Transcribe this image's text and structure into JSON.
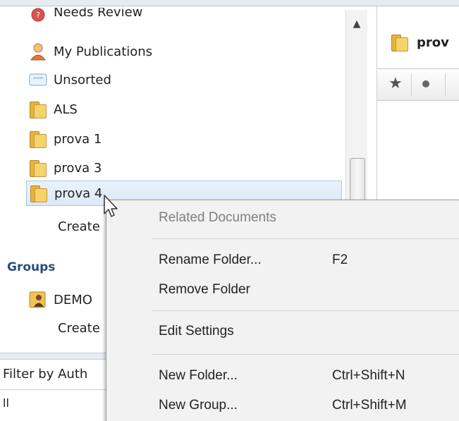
{
  "sidebar": {
    "items": [
      {
        "label": "Needs Review",
        "icon": "needs-review-icon"
      },
      {
        "label": "My Publications",
        "icon": "user-icon"
      },
      {
        "label": "Unsorted",
        "icon": "unsorted-icon"
      },
      {
        "label": "ALS",
        "icon": "folder-icon"
      },
      {
        "label": "prova 1",
        "icon": "folder-icon"
      },
      {
        "label": "prova 3",
        "icon": "folder-icon"
      },
      {
        "label": "prova 4",
        "icon": "folder-icon"
      }
    ],
    "create_folder_label": "Create",
    "groups_label": "Groups",
    "group_items": [
      {
        "label": "DEMO",
        "icon": "group-icon"
      }
    ],
    "create_group_label": "Create"
  },
  "filter": {
    "label": "Filter by Auth",
    "value": "ll"
  },
  "right_pane": {
    "folder_title": "prov"
  },
  "context_menu": {
    "related_documents": "Related Documents",
    "rename_folder": "Rename Folder...",
    "rename_shortcut": "F2",
    "remove_folder": "Remove Folder",
    "edit_settings": "Edit Settings",
    "new_folder": "New Folder...",
    "new_folder_shortcut": "Ctrl+Shift+N",
    "new_group": "New Group...",
    "new_group_shortcut": "Ctrl+Shift+M"
  },
  "colors": {
    "selection_bg": "#dde9f7",
    "selection_border": "#a8c4e6",
    "menu_bg": "#f2f2f2",
    "groups_heading": "#2b4b7a",
    "folder_yellow": "#f7d36b"
  }
}
